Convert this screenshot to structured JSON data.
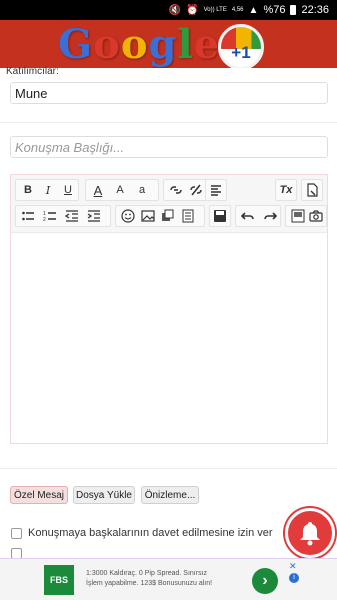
{
  "status_bar": {
    "network_label": "Vo)) LTE",
    "network_label_top": "4G",
    "signal_text": "4,56",
    "battery": "%76",
    "time": "22:36"
  },
  "header": {
    "logo_letters": [
      "G",
      "o",
      "o",
      "g",
      "l",
      "e"
    ],
    "badge_text": "+1"
  },
  "form": {
    "participants_label": "Katılımcılar:",
    "participants_value": "Mune",
    "subject_placeholder": "Konuşma Başlığı..."
  },
  "toolbar": {
    "row1": [
      {
        "name": "bold-button",
        "glyph": "B"
      },
      {
        "name": "italic-button",
        "glyph": "I"
      },
      {
        "name": "underline-button",
        "glyph": "U"
      },
      {
        "name": "font-color-button",
        "glyph": "A"
      },
      {
        "name": "font-size-button",
        "glyph": "A"
      },
      {
        "name": "font-family-button",
        "glyph": "a"
      },
      {
        "name": "link-button",
        "glyph": "link"
      },
      {
        "name": "unlink-button",
        "glyph": "unlink"
      },
      {
        "name": "align-button",
        "glyph": "align"
      },
      {
        "name": "clear-format-button",
        "glyph": "Tx"
      },
      {
        "name": "new-page-button",
        "glyph": "page"
      }
    ],
    "row2": [
      {
        "name": "bullet-list-button"
      },
      {
        "name": "numbered-list-button"
      },
      {
        "name": "outdent-button"
      },
      {
        "name": "indent-button"
      },
      {
        "name": "smiley-button"
      },
      {
        "name": "image-button"
      },
      {
        "name": "media-button"
      },
      {
        "name": "template-button"
      },
      {
        "name": "save-button"
      },
      {
        "name": "undo-button"
      },
      {
        "name": "redo-button"
      },
      {
        "name": "quote-button"
      },
      {
        "name": "camera-button"
      }
    ]
  },
  "actions": {
    "private_message": "Özel Mesaj",
    "upload_file": "Dosya Yükle",
    "preview": "Önizleme..."
  },
  "options": {
    "allow_invite_label": "Konuşmaya başkalarının davet edilmesine izin ver"
  },
  "ad": {
    "logo_text": "FBS",
    "line1": "1:3000 Kaldıraç. 0 Pip Spread. Sınırsız",
    "line2": "İşlem yapabilme. 123$ Bonusunuzu alın!",
    "cta_glyph": "›",
    "close_glyph": "✕",
    "info_glyph": "i"
  },
  "colors": {
    "header_bg": "#c4311f",
    "bell_bg": "#e23b3b",
    "ad_green": "#1b8a3a"
  }
}
